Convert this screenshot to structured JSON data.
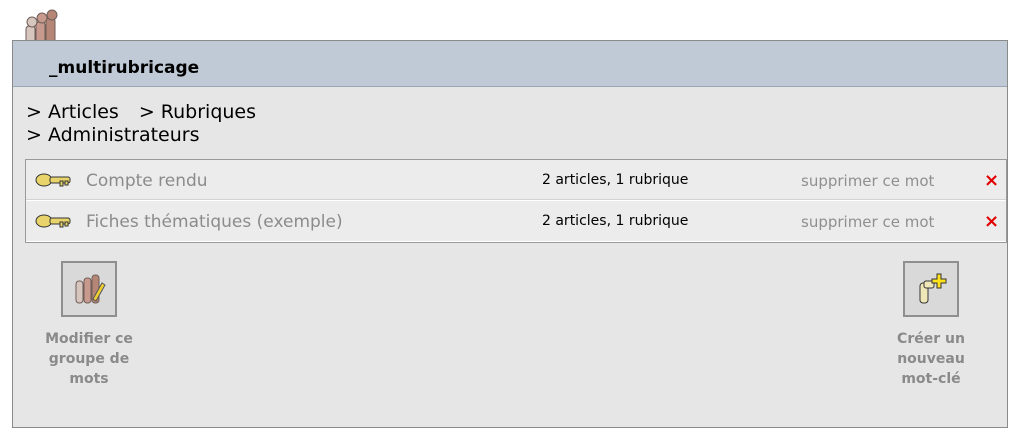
{
  "group": {
    "title": "_multirubricage"
  },
  "links": {
    "articles": "> Articles",
    "rubriques": "> Rubriques",
    "administrateurs": "> Administrateurs"
  },
  "keywords": [
    {
      "name": "Compte rendu",
      "usage": "2 articles, 1 rubrique",
      "delete_label": "supprimer ce mot"
    },
    {
      "name": "Fiches thématiques (exemple)",
      "usage": "2 articles, 1 rubrique",
      "delete_label": "supprimer ce mot"
    }
  ],
  "actions": {
    "modify": {
      "line1": "Modifier ce",
      "line2": "groupe de",
      "line3": "mots"
    },
    "create": {
      "line1": "Créer un",
      "line2": "nouveau",
      "line3": "mot-clé"
    }
  },
  "icons": {
    "group_icon": "keys-group-icon",
    "keyword_icon": "key-icon",
    "delete_icon": "delete-x-icon",
    "modify_icon": "edit-group-icon",
    "create_icon": "add-keyword-icon"
  },
  "colors": {
    "delete_accent": "#e10000",
    "header_bg": "#bfcad6",
    "panel_bg": "#e6e6e6"
  }
}
